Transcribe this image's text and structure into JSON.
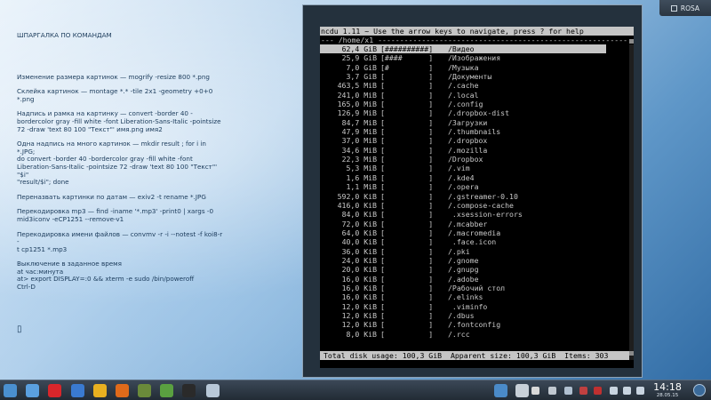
{
  "panel": {
    "user_label": "ROSA"
  },
  "notes": {
    "title": "ШПАРГАЛКА ПО КОМАНДАМ",
    "blocks": [
      [
        "Изменение размера картинок — mogrify -resize 800 *.png"
      ],
      [
        "Склейка картинок — montage *.* -tile 2x1 -geometry +0+0 *.png"
      ],
      [
        "Надпись и рамка на картинку — convert -border 40 -",
        "bordercolor gray -fill white -font Liberation-Sans-Italic -pointsize",
        "72 -draw 'text 80 100 \"Текст\"' имя.png имя2"
      ],
      [
        "Одна надпись на много картинок — mkdir result ; for i in *.JPG;",
        "do convert -border 40 -bordercolor gray -fill white -font",
        "Liberation-Sans-Italic -pointsize 72 -draw 'text 80 100 \"Текст\"' \"$i\"",
        "\"result/$i\"; done"
      ],
      [
        "Переназвать картинки по датам — exiv2 -t rename *.JPG"
      ],
      [
        "Перекодировка mp3 — find -iname '*.mp3' -print0 | xargs -0",
        "mid3iconv -eCP1251 --remove-v1"
      ],
      [
        "Перекодировка имени файлов — convmv -r -i --notest -f koi8-r -",
        "t cp1251 *.mp3"
      ],
      [
        "Выключение в заданное время",
        "at час:минута",
        "at> export DISPLAY=:0 && xterm -e sudo /bin/poweroff",
        "Ctrl-D"
      ]
    ]
  },
  "terminal": {
    "header": "ncdu 1.11 ~ Use the arrow keys to navigate, press ? for help",
    "subheader": "--- /home/x1 ---------------------------------------------------------",
    "rows": [
      {
        "size": "62,4 GiB",
        "bar": "[##########]",
        "name": "/Видео",
        "selected": true
      },
      {
        "size": "25,9 GiB",
        "bar": "[####      ]",
        "name": "/Изображения"
      },
      {
        "size": "7,0 GiB",
        "bar": "[#         ]",
        "name": "/Музыка"
      },
      {
        "size": "3,7 GiB",
        "bar": "[          ]",
        "name": "/Документы"
      },
      {
        "size": "463,5 MiB",
        "bar": "[          ]",
        "name": "/.cache"
      },
      {
        "size": "241,0 MiB",
        "bar": "[          ]",
        "name": "/.local"
      },
      {
        "size": "165,0 MiB",
        "bar": "[          ]",
        "name": "/.config"
      },
      {
        "size": "126,9 MiB",
        "bar": "[          ]",
        "name": "/.dropbox-dist"
      },
      {
        "size": "84,7 MiB",
        "bar": "[          ]",
        "name": "/Загрузки"
      },
      {
        "size": "47,9 MiB",
        "bar": "[          ]",
        "name": "/.thumbnails"
      },
      {
        "size": "37,0 MiB",
        "bar": "[          ]",
        "name": "/.dropbox"
      },
      {
        "size": "34,6 MiB",
        "bar": "[          ]",
        "name": "/.mozilla"
      },
      {
        "size": "22,3 MiB",
        "bar": "[          ]",
        "name": "/Dropbox"
      },
      {
        "size": "5,3 MiB",
        "bar": "[          ]",
        "name": "/.vim"
      },
      {
        "size": "1,6 MiB",
        "bar": "[          ]",
        "name": "/.kde4"
      },
      {
        "size": "1,1 MiB",
        "bar": "[          ]",
        "name": "/.opera"
      },
      {
        "size": "592,0 KiB",
        "bar": "[          ]",
        "name": "/.gstreamer-0.10"
      },
      {
        "size": "416,0 KiB",
        "bar": "[          ]",
        "name": "/.compose-cache"
      },
      {
        "size": "84,0 KiB",
        "bar": "[          ]",
        "name": " .xsession-errors"
      },
      {
        "size": "72,0 KiB",
        "bar": "[          ]",
        "name": "/.mcabber"
      },
      {
        "size": "64,0 KiB",
        "bar": "[          ]",
        "name": "/.macromedia"
      },
      {
        "size": "40,0 KiB",
        "bar": "[          ]",
        "name": " .face.icon"
      },
      {
        "size": "36,0 KiB",
        "bar": "[          ]",
        "name": "/.pki"
      },
      {
        "size": "24,0 KiB",
        "bar": "[          ]",
        "name": "/.gnome"
      },
      {
        "size": "20,0 KiB",
        "bar": "[          ]",
        "name": "/.gnupg"
      },
      {
        "size": "16,0 KiB",
        "bar": "[          ]",
        "name": "/.adobe"
      },
      {
        "size": "16,0 KiB",
        "bar": "[          ]",
        "name": "/Рабочий стол"
      },
      {
        "size": "16,0 KiB",
        "bar": "[          ]",
        "name": "/.elinks"
      },
      {
        "size": "12,0 KiB",
        "bar": "[          ]",
        "name": " .viminfo"
      },
      {
        "size": "12,0 KiB",
        "bar": "[          ]",
        "name": "/.dbus"
      },
      {
        "size": "12,0 KiB",
        "bar": "[          ]",
        "name": "/.fontconfig"
      },
      {
        "size": "8,0 KiB",
        "bar": "[          ]",
        "name": "/.rcc"
      }
    ],
    "footer": "Total disk usage: 100,3 GiB  Apparent size: 100,3 GiB  Items: 303"
  },
  "taskbar": {
    "time": "14:18",
    "date": "28.05.15",
    "launchers": [
      {
        "icon": "rosa-menu-icon",
        "color": "#4a90d0"
      },
      {
        "icon": "home-folder-icon",
        "color": "#5aa0e0"
      },
      {
        "icon": "opera-icon",
        "color": "#d8262b"
      },
      {
        "icon": "opera-beta-icon",
        "color": "#3a7ad0"
      },
      {
        "icon": "chrome-icon",
        "color": "#e8b020"
      },
      {
        "icon": "firefox-icon",
        "color": "#e06a1a"
      },
      {
        "icon": "media-player-icon",
        "color": "#6a8a3a"
      },
      {
        "icon": "video-player-icon",
        "color": "#5aa040"
      },
      {
        "icon": "terminal-icon",
        "color": "#2a2a2a"
      },
      {
        "icon": "files-icon",
        "color": "#b8c8d8"
      }
    ],
    "tray": [
      {
        "icon": "screenshot-icon",
        "color": "#4a8ac8"
      },
      {
        "icon": "clipboard-icon",
        "color": "#c8d0d8"
      },
      {
        "icon": "notes-icon",
        "color": "#d8d8d8"
      },
      {
        "icon": "usb-icon",
        "color": "#c0c8d0"
      },
      {
        "icon": "network-icon",
        "color": "#b0c0d0"
      },
      {
        "icon": "close-icon",
        "color": "#c04040"
      },
      {
        "icon": "keyboard-layout-icon",
        "color": "#c03030"
      },
      {
        "icon": "volume-icon",
        "color": "#c8d4e0"
      },
      {
        "icon": "wifi-icon",
        "color": "#c8d4e0"
      },
      {
        "icon": "battery-icon",
        "color": "#c8d4e0"
      }
    ]
  }
}
